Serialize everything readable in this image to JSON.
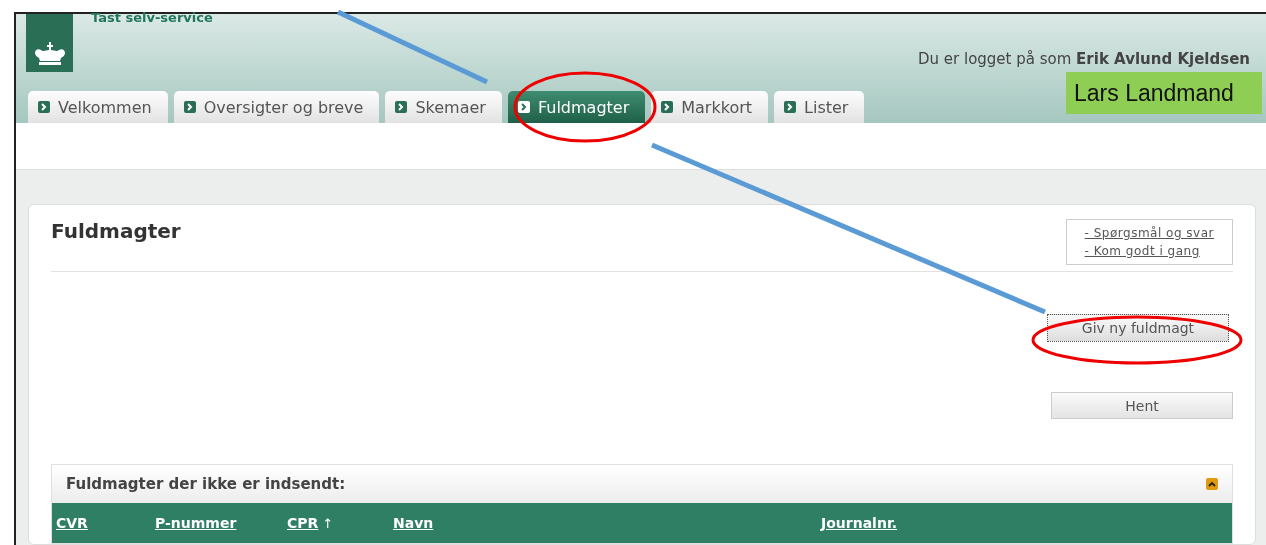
{
  "header": {
    "service_name": "Tast selv-service",
    "login_text": "Du er logget på som **Erik Avlund Kjeldsen**"
  },
  "tabs": [
    {
      "label": "Velkommen",
      "selected": false
    },
    {
      "label": "Oversigter og breve",
      "selected": false
    },
    {
      "label": "Skemaer",
      "selected": false
    },
    {
      "label": "Fuldmagter",
      "selected": true
    },
    {
      "label": "Markkort",
      "selected": false
    },
    {
      "label": "Lister",
      "selected": false
    }
  ],
  "panel": {
    "title": "Fuldmagter",
    "help_links": [
      "- Spørgsmål og svar",
      "- Kom godt i gang"
    ],
    "new_button": "Giv ny fuldmagt",
    "fetch_button": "Hent"
  },
  "section": {
    "title": "Fuldmagter der ikke er indsendt:",
    "expanded": true,
    "columns": [
      {
        "label": "CVR"
      },
      {
        "label": "P-nummer"
      },
      {
        "label": "CPR",
        "sort_mark": "↑"
      },
      {
        "label": "Navn"
      },
      {
        "label": "Journalnr."
      }
    ]
  },
  "annotation": {
    "label": "Lars Landmand"
  }
}
